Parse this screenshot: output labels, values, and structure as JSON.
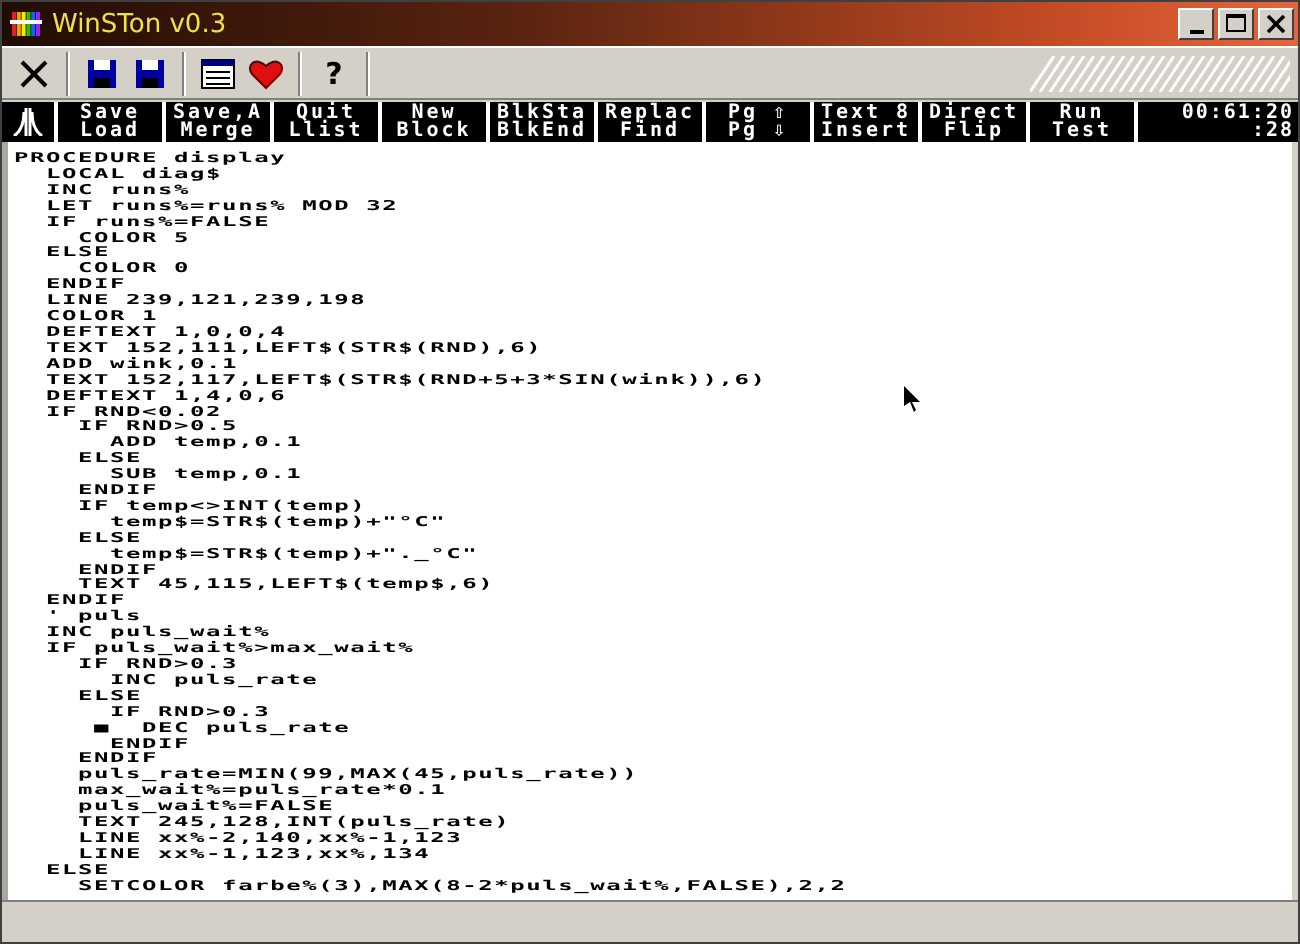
{
  "window": {
    "title": "WinSTon v0.3"
  },
  "toolbar": [
    [
      {
        "kind": "close"
      }
    ],
    [
      {
        "kind": "disk"
      },
      {
        "kind": "disk"
      }
    ],
    [
      {
        "kind": "sheet"
      },
      {
        "kind": "heart"
      }
    ],
    [
      {
        "kind": "help",
        "label": "?"
      }
    ]
  ],
  "function_keys": [
    {
      "top": "Save",
      "bottom": "Load"
    },
    {
      "top": "Save,A",
      "bottom": "Merge"
    },
    {
      "top": "Quit",
      "bottom": "Llist"
    },
    {
      "top": "New",
      "bottom": "Block"
    },
    {
      "top": "BlkSta",
      "bottom": "BlkEnd"
    },
    {
      "top": "Replac",
      "bottom": "Find"
    },
    {
      "top": "Pg ⇧",
      "bottom": "Pg ⇩"
    },
    {
      "top": "Text 8",
      "bottom": "Insert"
    },
    {
      "top": "Direct",
      "bottom": "Flip"
    },
    {
      "top": "Run",
      "bottom": "Test"
    }
  ],
  "clock": {
    "time": "00:61:20",
    "seconds": ":28"
  },
  "code": [
    "PROCEDURE display",
    "  LOCAL diag$",
    "  INC runs%",
    "  LET runs%=runs% MOD 32",
    "  IF runs%=FALSE",
    "    COLOR 5",
    "  ELSE",
    "    COLOR 0",
    "  ENDIF",
    "  LINE 239,121,239,198",
    "  COLOR 1",
    "  DEFTEXT 1,0,0,4",
    "  TEXT 152,111,LEFT$(STR$(RND),6)",
    "  ADD wink,0.1",
    "  TEXT 152,117,LEFT$(STR$(RND+5+3*SIN(wink)),6)",
    "  DEFTEXT 1,4,0,6",
    "  IF RND<0.02",
    "    IF RND>0.5",
    "      ADD temp,0.1",
    "    ELSE",
    "      SUB temp,0.1",
    "    ENDIF",
    "    IF temp<>INT(temp)",
    "      temp$=STR$(temp)+\"°C\"",
    "    ELSE",
    "      temp$=STR$(temp)+\"._°C\"",
    "    ENDIF",
    "    TEXT 45,115,LEFT$(temp$,6)",
    "  ENDIF",
    "  ' puls",
    "  INC puls_wait%",
    "  IF puls_wait%>max_wait%",
    "    IF RND>0.3",
    "      INC puls_rate",
    "    ELSE",
    "      IF RND>0.3",
    "     ■  DEC puls_rate",
    "      ENDIF",
    "    ENDIF",
    "    puls_rate=MIN(99,MAX(45,puls_rate))",
    "    max_wait%=puls_rate*0.1",
    "    puls_wait%=FALSE",
    "    TEXT 245,128,INT(puls_rate)",
    "    LINE xx%-2,140,xx%-1,123",
    "    LINE xx%-1,123,xx%,134",
    "  ELSE",
    "    SETCOLOR farbe%(3),MAX(8-2*puls_wait%,FALSE),2,2"
  ]
}
